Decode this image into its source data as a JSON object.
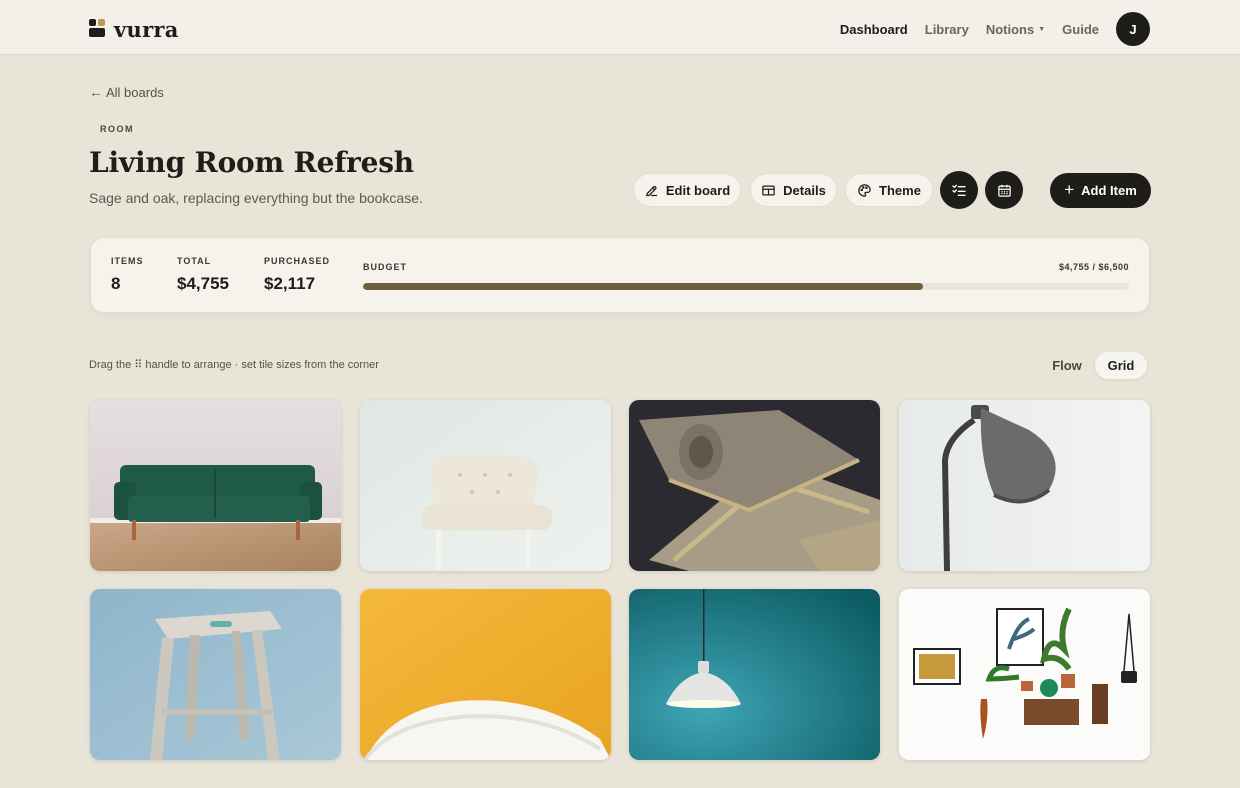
{
  "brand": {
    "name": "vurra"
  },
  "nav": {
    "items": [
      {
        "label": "Dashboard",
        "active": true
      },
      {
        "label": "Library",
        "active": false
      },
      {
        "label": "Notions",
        "active": false,
        "has_dropdown": true
      },
      {
        "label": "Guide",
        "active": false
      }
    ],
    "avatar_initial": "J"
  },
  "page": {
    "back_label": "All boards",
    "eyebrow": "ROOM",
    "title": "Living Room Refresh",
    "subtitle": "Sage and oak, replacing everything but the bookcase."
  },
  "toolbar": {
    "edit_label": "Edit board",
    "details_label": "Details",
    "theme_label": "Theme",
    "add_label": "Add Item",
    "icons": [
      "pencil-icon",
      "table-icon",
      "palette-icon",
      "checklist-icon",
      "calendar-icon",
      "plus-icon"
    ]
  },
  "stats": {
    "items_label": "ITEMS",
    "items_value": "8",
    "total_label": "TOTAL",
    "total_value": "$4,755",
    "purchased_label": "PURCHASED",
    "purchased_value": "$2,117",
    "budget_label": "BUDGET",
    "budget_amount": "$4,755 / $6,500",
    "budget_fraction": 0.7315
  },
  "layout_hint": "Drag the ⠿ handle to arrange · set tile sizes from the corner",
  "view_toggle": {
    "flow_label": "Flow",
    "grid_label": "Grid",
    "selected": "Grid"
  },
  "tiles": [
    {
      "subject": "green velvet sofa"
    },
    {
      "subject": "white tufted armchair"
    },
    {
      "subject": "rolled patterned rug"
    },
    {
      "subject": "grey floor lamp"
    },
    {
      "subject": "wooden stool"
    },
    {
      "subject": "white pillow"
    },
    {
      "subject": "pendant lamp"
    },
    {
      "subject": "wall shelves with plants"
    }
  ],
  "colors": {
    "background": "#e8e4d8",
    "surface": "#f5f3ec",
    "ink": "#1f1d1a",
    "budget_fill": "#6e5f3e",
    "brand_accent": "#b79b54"
  }
}
